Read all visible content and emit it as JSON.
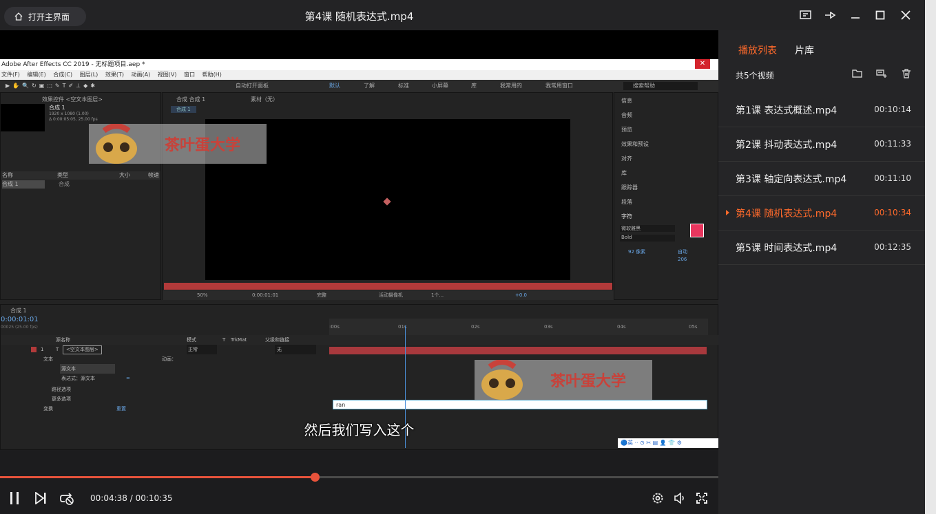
{
  "window": {
    "title": "第4课 随机表达式.mp4",
    "home_label": "打开主界面"
  },
  "video": {
    "subtitle": "然后我们写入这个",
    "watermark": "茶叶蛋大学",
    "ae": {
      "app_title": "Adobe After Effects CC 2019 - 无标题项目.aep *",
      "menu": [
        "文件(F)",
        "编辑(E)",
        "合成(C)",
        "图层(L)",
        "效果(T)",
        "动画(A)",
        "视图(V)",
        "窗口",
        "帮助(H)"
      ],
      "auto_open": "自动打开面板",
      "workspaces": [
        "默认",
        "了解",
        "标准",
        "小屏幕",
        "库",
        "我常用的",
        "我常用窗口"
      ],
      "search_placeholder": "搜索帮助",
      "project_tab": "效果控件 <空文本图层>",
      "comp_name": "合成 1",
      "comp_info1": "1920 x 1080 (1.00)",
      "comp_info2": "Δ 0:00:05:05, 25.00 fps",
      "proj_cols": [
        "名称",
        "类型",
        "大小",
        "帧速"
      ],
      "proj_row": [
        "合成 1",
        "合成"
      ],
      "comp_tab": "合成 合成 1",
      "footage_tab": "素材（无）",
      "comp_subtab": "合成 1",
      "zoom": "50%",
      "timecode": "0:00:01:01",
      "quality": "完整",
      "camera": "活动摄像机",
      "views": "1个...",
      "exposure": "+0.0",
      "info_panels": [
        "信息",
        "音频",
        "预览",
        "效果和预设",
        "对齐",
        "库",
        "跟踪器",
        "段落",
        "字符"
      ],
      "font": "微软雅黑",
      "font_style": "Bold",
      "font_size": "92 像素",
      "leading": "自动",
      "tracking": "206",
      "tl_tab": "合成 1",
      "tl_time": "0:00:01:01",
      "tl_fps": "00025 (25.00 fps)",
      "tl_cols": [
        "源名称",
        "模式",
        "T",
        "TrkMat",
        "父级和链接"
      ],
      "layer": "<空文本图层>",
      "layer_mode": "正常",
      "layer_parent": "无",
      "props": [
        "文本",
        "源文本",
        "表达式：源文本",
        "路径选项",
        "更多选项",
        "变换"
      ],
      "animate": "动画：",
      "reset": "重置",
      "ruler": [
        ":00s",
        "01s",
        "02s",
        "03s",
        "04s",
        "05s"
      ],
      "expression": "ran"
    }
  },
  "player": {
    "current": "00:04:38",
    "total": "00:10:35",
    "time_text": "00:04:38 / 00:10:35",
    "progress_fraction": 0.438
  },
  "sidebar": {
    "tabs": [
      "播放列表",
      "片库"
    ],
    "count": "共5个视频",
    "items": [
      {
        "title": "第1课 表达式概述.mp4",
        "duration": "00:10:14"
      },
      {
        "title": "第2课 抖动表达式.mp4",
        "duration": "00:11:33"
      },
      {
        "title": "第3课 轴定向表达式.mp4",
        "duration": "00:11:10"
      },
      {
        "title": "第4课 随机表达式.mp4",
        "duration": "00:10:34"
      },
      {
        "title": "第5课 时间表达式.mp4",
        "duration": "00:12:35"
      }
    ]
  },
  "colors": {
    "accent": "#ff6a2b",
    "progress": "#e8533b"
  }
}
